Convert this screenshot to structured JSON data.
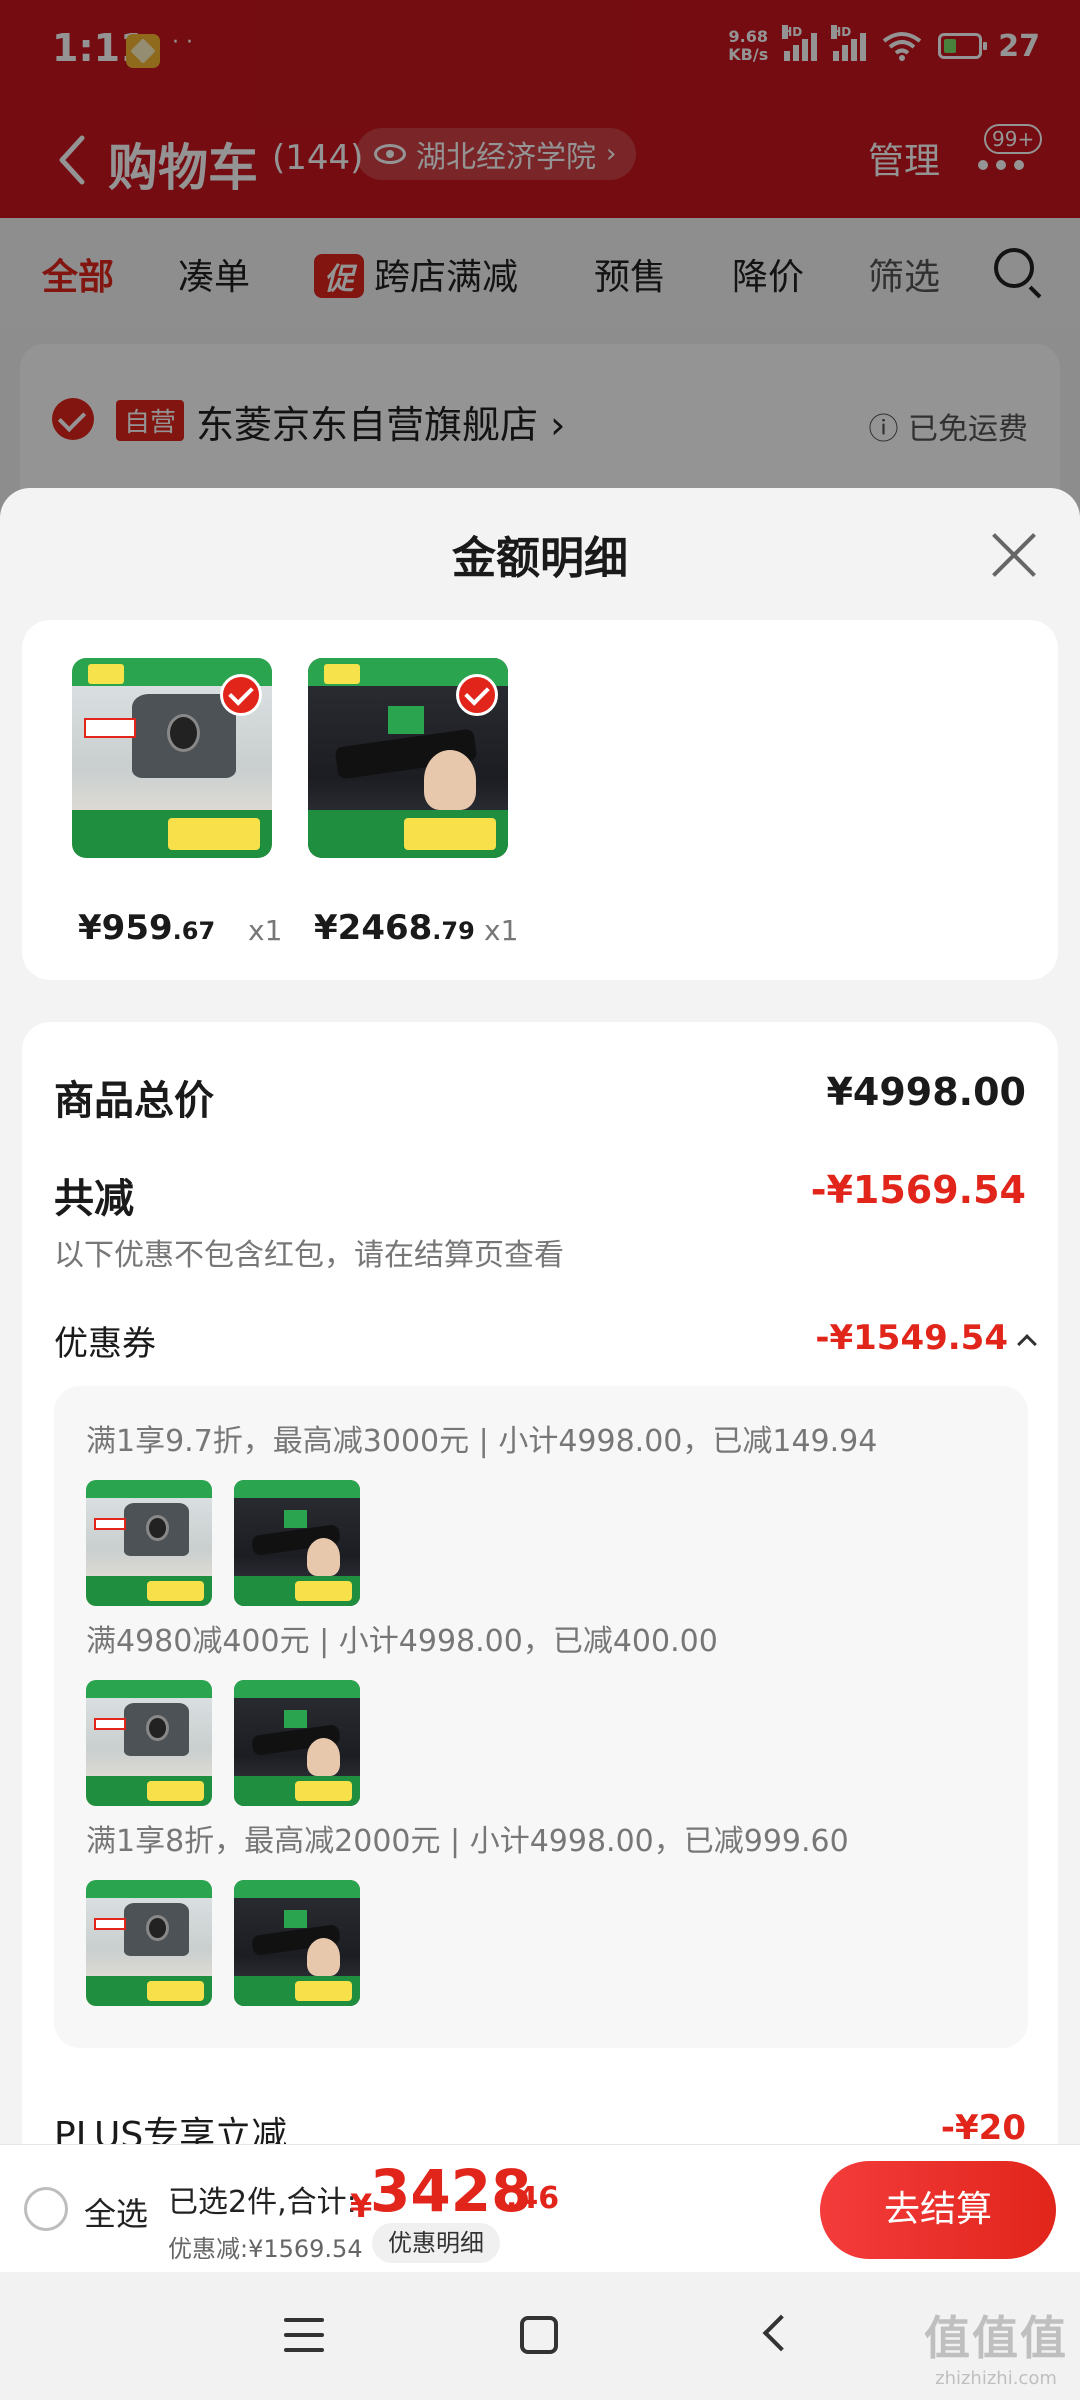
{
  "status_bar": {
    "time": "1:11",
    "app_dots": "· ·",
    "net_speed_value": "9.68",
    "net_speed_unit": "KB/s",
    "hd1": "HD",
    "hd2": "HD",
    "battery_percent": "27"
  },
  "header": {
    "title": "购物车",
    "count": "(144)",
    "location": "湖北经济学院",
    "manage_label": "管理",
    "more_badge": "99+"
  },
  "tabs": {
    "all": "全部",
    "combine": "凑单",
    "promo_tag": "促",
    "cross_store": "跨店满减",
    "presale": "预售",
    "price_drop": "降价",
    "filter": "筛选"
  },
  "store": {
    "self_tag": "自营",
    "name": "东菱京东自营旗舰店 ›",
    "free_shipping": "ⓘ 已免运费"
  },
  "sheet": {
    "title": "金额明细",
    "items": [
      {
        "price_main": "¥959",
        "price_decimal": ".67",
        "qty": "x1"
      },
      {
        "price_main": "¥2468",
        "price_decimal": ".79",
        "qty": "x1"
      }
    ],
    "total_label": "商品总价",
    "total_value": "¥4998.00",
    "reduce_label": "共减",
    "reduce_value": "-¥1569.54",
    "note": "以下优惠不包含红包，请在结算页查看",
    "coupon_label": "优惠券",
    "coupon_value": "-¥1549.54",
    "coupon_rules": [
      "满1享9.7折，最高减3000元 | 小计4998.00，已减149.94",
      "满4980减400元 | 小计4998.00，已减400.00",
      "满1享8折，最高减2000元 | 小计4998.00，已减999.60"
    ],
    "plus_label": "PLUS专享立减",
    "plus_value": "-¥20"
  },
  "checkout": {
    "select_all": "全选",
    "selected_text": "已选2件,合计:",
    "currency": "¥",
    "total_main": "3428",
    "total_decimal": ".46",
    "discount_text": "优惠减:¥1569.54",
    "detail_label": "优惠明细",
    "checkout_label": "去结算"
  },
  "watermark": {
    "big": "值值值",
    "small": "zhizhizhi.com"
  },
  "colors": {
    "brand_red": "#c8161e",
    "accent_red": "#e1251b",
    "promo_green": "#1f8f3f"
  },
  "icons": [
    "back-icon",
    "eye-icon",
    "more-icon",
    "search-icon",
    "close-icon",
    "check-icon",
    "chevron-up-icon",
    "menu-icon",
    "home-icon",
    "nav-back-icon"
  ]
}
